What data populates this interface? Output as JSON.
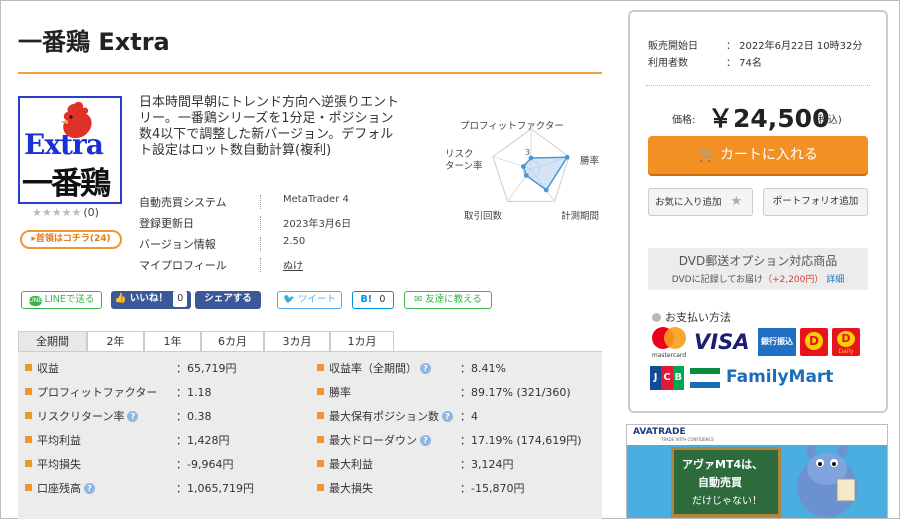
{
  "product": {
    "title": "一番鶏 Extra",
    "logo_text_top": "Extra",
    "logo_text_bottom": "一番鶏",
    "stars": "★★★★★",
    "review_count": "(0)",
    "review_button": "▸首領はコチラ(24)",
    "description": "日本時間早朝にトレンド方向へ逆張りエントリー。一番鶏シリーズを1分足・ポジション数4以下で調整した新バージョン。デフォルト設定はロット数自動計算(複利)"
  },
  "info": [
    {
      "label": "自動売買システム",
      "value": "MetaTrader 4"
    },
    {
      "label": "登録更新日",
      "value": "2023年3月6日"
    },
    {
      "label": "バージョン情報",
      "value": "2.50"
    },
    {
      "label": "マイプロフィール",
      "value": "ぬけ"
    }
  ],
  "radar": {
    "labels": {
      "top": "プロフィットファクター",
      "right": "勝率",
      "bottom_right": "計測期間",
      "bottom_left": "取引回数",
      "left_1": "リスク",
      "left_2": "ターン率"
    },
    "scale_label": "3",
    "values": {
      "profit_factor": 1.1,
      "win_rate": 3.8,
      "period": 2.6,
      "trades": 0.8,
      "risk_return": 0.8
    }
  },
  "social": {
    "line": "LINEで送る",
    "like": "いいね！",
    "like_count": "0",
    "share": "シェアする",
    "tweet": "ツイート",
    "hatena": "B!",
    "hatena_count": "0",
    "tell_friend": "友達に教える"
  },
  "tabs": [
    "全期間",
    "2年",
    "1年",
    "6カ月",
    "3カ月",
    "1カ月"
  ],
  "stats_left": [
    {
      "label": "収益",
      "value": "：65,719円",
      "help": false
    },
    {
      "label": "プロフィットファクター",
      "value": "：1.18",
      "help": false
    },
    {
      "label": "リスクリターン率",
      "value": "：0.38",
      "help": true
    },
    {
      "label": "平均利益",
      "value": "：1,428円",
      "help": false
    },
    {
      "label": "平均損失",
      "value": "：-9,964円",
      "help": false
    },
    {
      "label": "口座残高",
      "value": "：1,065,719円",
      "help": true
    }
  ],
  "stats_right": [
    {
      "label": "収益率（全期間）",
      "value": "：8.41%",
      "help": true
    },
    {
      "label": "勝率",
      "value": "：89.17% (321/360)",
      "help": false
    },
    {
      "label": "最大保有ポジション数",
      "value": "：4",
      "help": true
    },
    {
      "label": "最大ドローダウン",
      "value": "：17.19% (174,619円)",
      "help": true
    },
    {
      "label": "最大利益",
      "value": "：3,124円",
      "help": false
    },
    {
      "label": "最大損失",
      "value": "：-15,870円",
      "help": false
    }
  ],
  "sidebar": {
    "release_label": "販売開始日",
    "release_value": "：  2022年6月22日 10時32分",
    "users_label": "利用者数",
    "users_value": "：  74名",
    "price_label": "価格:",
    "price": "￥24,500",
    "price_tax": "(税込)",
    "cart": "カートに入れる",
    "favorite": "お気に入り追加",
    "portfolio": "ポートフォリオ追加",
    "dvd_title": "DVD郵送オプション対応商品",
    "dvd_note": "DVDに記録してお届け",
    "dvd_price": "（+2,200円）",
    "dvd_detail": "詳細",
    "payment_title": "お支払い方法",
    "payments": {
      "mastercard": "mastercard",
      "visa": "VISA",
      "bank": "銀行振込",
      "daily": "Daily",
      "jcb": "JCB",
      "familymart": "FamilyMart"
    }
  },
  "ad": {
    "brand": "AVATRADE",
    "tagline": "TRADE WITH CONFIDENCE",
    "line1": "アヴァMT4は、",
    "line2": "自動売買",
    "line3": "だけじゃない！"
  },
  "colors": {
    "accent": "#f39024",
    "title_line": "#f0a040",
    "stats_bg": "#ececec",
    "facebook": "#3b5998",
    "twitter_border": "#55acee",
    "line_green": "#3cb34a"
  }
}
